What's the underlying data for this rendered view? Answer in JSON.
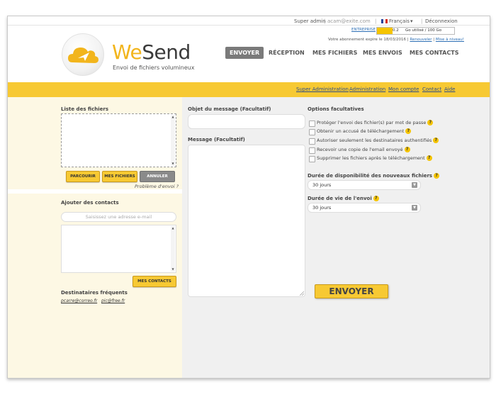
{
  "topbar": {
    "user_role": "Super admin",
    "email": "acam@exite.com",
    "language": "Français",
    "language_arrow": "▾",
    "logout": "Déconnexion",
    "flag_colors": [
      "#1e3c9a",
      "#ffffff",
      "#d52b1e"
    ]
  },
  "quota": {
    "label": "ENTREPRISE",
    "percent": "0.2",
    "fill_fraction": 0.2,
    "usage": "Go utilisé / 100 Go",
    "subscription_text": "Votre abonnement expire le 18/03/2016 |",
    "renew_link": "Renouveler",
    "upgrade_link": "Mise à niveau!"
  },
  "brand": {
    "name_part1": "We",
    "name_part2": "Send",
    "tagline": "Envoi de fichiers volumineux",
    "accent_color": "#f2b51c"
  },
  "nav": {
    "items": [
      "ENVOYER",
      "RÉCEPTION",
      "MES FICHIERS",
      "MES ENVOIS",
      "MES CONTACTS"
    ],
    "active": "ENVOYER"
  },
  "admin_links": [
    "Super Administration",
    "Administration",
    "Mon compte",
    "Contact",
    "Aide"
  ],
  "files": {
    "title": "Liste des fichiers",
    "browse_button": "PARCOURIR",
    "my_files_button": "MES FICHIERS",
    "cancel_button": "ANNULER",
    "problem_link": "Problème d'envoi ?"
  },
  "contacts": {
    "title": "Ajouter des contacts",
    "placeholder": "Saisissez une adresse e-mail",
    "my_contacts_button": "MES CONTACTS",
    "frequent_title": "Destinataires fréquents",
    "frequent": [
      "pcarre@correo.fr",
      "pic@free.fr"
    ]
  },
  "message": {
    "subject_label": "Objet du message (Facultatif)",
    "body_label": "Message (Facultatif)"
  },
  "options": {
    "title": "Options facultatives",
    "items": [
      "Protéger l'envoi des fichier(s) par mot de passe",
      "Obtenir un accusé de téléchargement",
      "Autoriser seulement les destinataires authentifiés",
      "Recevoir une copie de l'email envoyé",
      "Supprimer les fichiers après le téléchargement"
    ],
    "help_glyph": "?",
    "availability_label": "Durée de disponibilité des nouveaux fichiers",
    "availability_value": "30 jours",
    "lifetime_label": "Durée de vie de l'envoi",
    "lifetime_value": "30 jours"
  },
  "send_button": "ENVOYER"
}
